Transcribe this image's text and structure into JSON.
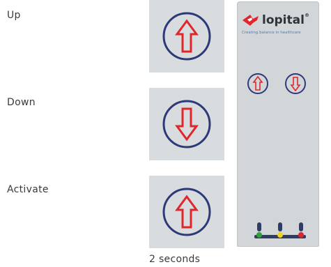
{
  "rows": [
    {
      "label": "Up",
      "icon": "up-arrow-icon"
    },
    {
      "label": "Down",
      "icon": "down-arrow-icon"
    },
    {
      "label": "Activate",
      "icon": "up-arrow-icon"
    }
  ],
  "caption": "2 seconds",
  "remote": {
    "brand": "lopital",
    "brand_mark": "®",
    "tagline": "Creating balance in healthcare",
    "buttons": [
      "up-arrow-icon",
      "down-arrow-icon"
    ],
    "leds": [
      "green",
      "yellow",
      "red"
    ]
  },
  "colors": {
    "tile_bg": "#d8dcde",
    "circle": "#2e3a78",
    "arrow": "#e0262b",
    "led_green": "#2fa23a",
    "led_yellow": "#f3d21c",
    "led_red": "#e0262b"
  }
}
